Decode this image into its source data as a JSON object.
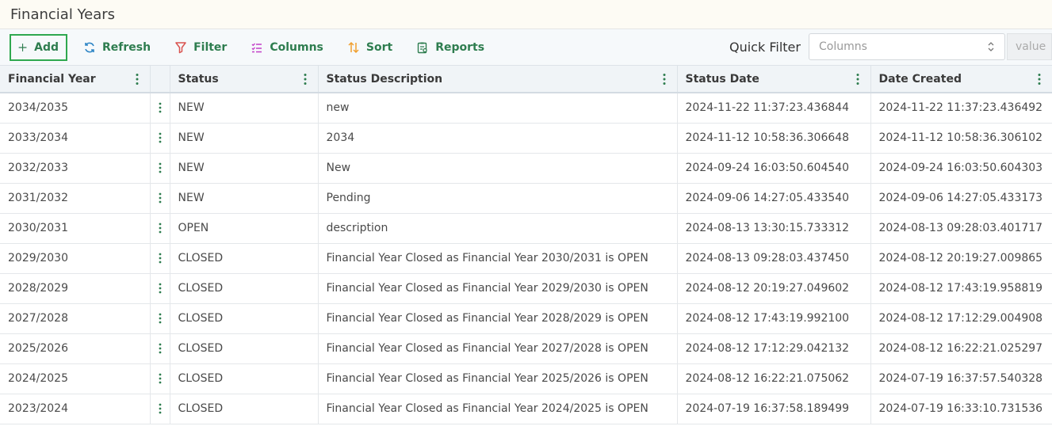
{
  "page": {
    "title": "Financial Years"
  },
  "toolbar": {
    "add_label": "Add",
    "refresh_label": "Refresh",
    "filter_label": "Filter",
    "columns_label": "Columns",
    "sort_label": "Sort",
    "reports_label": "Reports"
  },
  "quick_filter": {
    "label": "Quick Filter",
    "select_value": "Columns",
    "value_placeholder": "value"
  },
  "colors": {
    "accent_green": "#2e7d4f",
    "add_border": "#2fa84f",
    "filter_icon": "#d9534f",
    "columns_icon": "#c23fc8",
    "sort_icon": "#f0a030",
    "refresh_icon": "#2f86c6"
  },
  "table": {
    "headers": [
      "Financial Year",
      "",
      "Status",
      "Status Description",
      "Status Date",
      "Date Created"
    ],
    "rows": [
      [
        "2034/2035",
        "NEW",
        "new",
        "2024-11-22 11:37:23.436844",
        "2024-11-22 11:37:23.436492"
      ],
      [
        "2033/2034",
        "NEW",
        "2034",
        "2024-11-12 10:58:36.306648",
        "2024-11-12 10:58:36.306102"
      ],
      [
        "2032/2033",
        "NEW",
        "New",
        "2024-09-24 16:03:50.604540",
        "2024-09-24 16:03:50.604303"
      ],
      [
        "2031/2032",
        "NEW",
        "Pending",
        "2024-09-06 14:27:05.433540",
        "2024-09-06 14:27:05.433173"
      ],
      [
        "2030/2031",
        "OPEN",
        "description",
        "2024-08-13 13:30:15.733312",
        "2024-08-13 09:28:03.401717"
      ],
      [
        "2029/2030",
        "CLOSED",
        "Financial Year Closed as Financial Year 2030/2031 is OPEN",
        "2024-08-13 09:28:03.437450",
        "2024-08-12 20:19:27.009865"
      ],
      [
        "2028/2029",
        "CLOSED",
        "Financial Year Closed as Financial Year 2029/2030 is OPEN",
        "2024-08-12 20:19:27.049602",
        "2024-08-12 17:43:19.958819"
      ],
      [
        "2027/2028",
        "CLOSED",
        "Financial Year Closed as Financial Year 2028/2029 is OPEN",
        "2024-08-12 17:43:19.992100",
        "2024-08-12 17:12:29.004908"
      ],
      [
        "2025/2026",
        "CLOSED",
        "Financial Year Closed as Financial Year 2027/2028 is OPEN",
        "2024-08-12 17:12:29.042132",
        "2024-08-12 16:22:21.025297"
      ],
      [
        "2024/2025",
        "CLOSED",
        "Financial Year Closed as Financial Year 2025/2026 is OPEN",
        "2024-08-12 16:22:21.075062",
        "2024-07-19 16:37:57.540328"
      ],
      [
        "2023/2024",
        "CLOSED",
        "Financial Year Closed as Financial Year 2024/2025 is OPEN",
        "2024-07-19 16:37:58.189499",
        "2024-07-19 16:33:10.731536"
      ]
    ]
  }
}
